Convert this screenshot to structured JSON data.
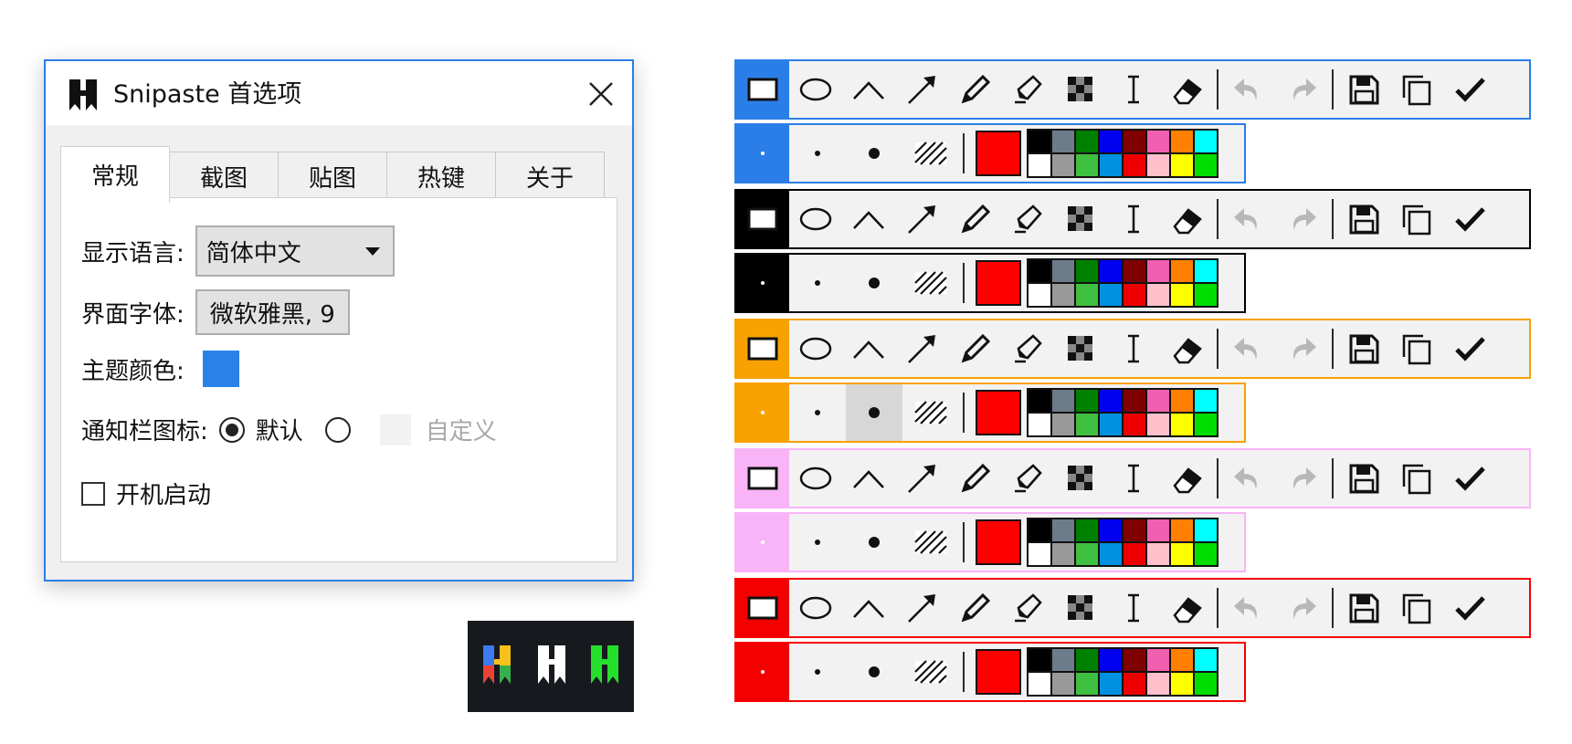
{
  "dialog": {
    "title": "Snipaste 首选项",
    "tabs": [
      "常规",
      "截图",
      "贴图",
      "热键",
      "关于"
    ],
    "active_tab": "常规",
    "language_label": "显示语言:",
    "language_value": "简体中文",
    "font_label": "界面字体:",
    "font_value": "微软雅黑, 9",
    "theme_label": "主题颜色:",
    "theme_color": "#2a82e8",
    "tray_label": "通知栏图标:",
    "tray_default": "默认",
    "tray_custom": "自定义",
    "startup_label": "开机启动",
    "startup_checked": false
  },
  "tray_icons": [
    "colorful-logo-icon",
    "white-logo-icon",
    "green-logo-icon"
  ],
  "toolbar_themes": [
    {
      "accent": "#2b7ee8"
    },
    {
      "accent": "#000000"
    },
    {
      "accent": "#f8a100"
    },
    {
      "accent": "#f8b4f6"
    },
    {
      "accent": "#f40000"
    }
  ],
  "toolbar_tools": [
    "rectangle-icon",
    "ellipse-icon",
    "polyline-icon",
    "arrow-icon",
    "pencil-icon",
    "marker-icon",
    "mosaic-icon",
    "text-icon",
    "eraser-icon",
    "undo-icon",
    "redo-icon",
    "save-icon",
    "copy-icon",
    "confirm-icon"
  ],
  "current_color": "#ff0000",
  "palette": [
    "#000000",
    "#6d7c8b",
    "#008000",
    "#0000f0",
    "#800000",
    "#f05fb0",
    "#ff8000",
    "#00ffff",
    "#ffffff",
    "#999999",
    "#40c040",
    "#0090e0",
    "#ee0000",
    "#ffc0cc",
    "#ffff00",
    "#00dd00"
  ]
}
